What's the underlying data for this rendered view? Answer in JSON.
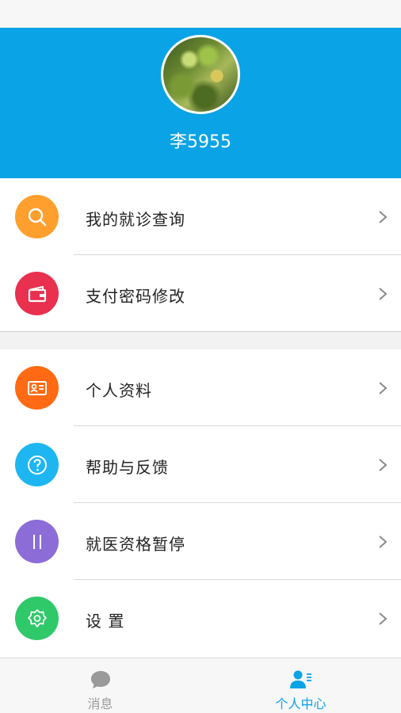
{
  "profile": {
    "username": "李5955"
  },
  "menu_group_1": [
    {
      "label": "我的就诊查询",
      "icon": "search-icon",
      "color": "#ff9f2e"
    },
    {
      "label": "支付密码修改",
      "icon": "wallet-icon",
      "color": "#e9304f"
    }
  ],
  "menu_group_2": [
    {
      "label": "个人资料",
      "icon": "id-card-icon",
      "color": "#ff6a13"
    },
    {
      "label": "帮助与反馈",
      "icon": "help-icon",
      "color": "#1eb6f0"
    },
    {
      "label": "就医资格暂停",
      "icon": "pause-icon",
      "color": "#8c6dd8"
    },
    {
      "label": "设 置",
      "icon": "gear-icon",
      "color": "#2fc96a"
    }
  ],
  "bottom_nav": {
    "messages_label": "消息",
    "profile_label": "个人中心",
    "active_color": "#0aa3e6",
    "inactive_color": "#9a9a9a"
  },
  "colors": {
    "header_bg": "#0aa3e6"
  }
}
